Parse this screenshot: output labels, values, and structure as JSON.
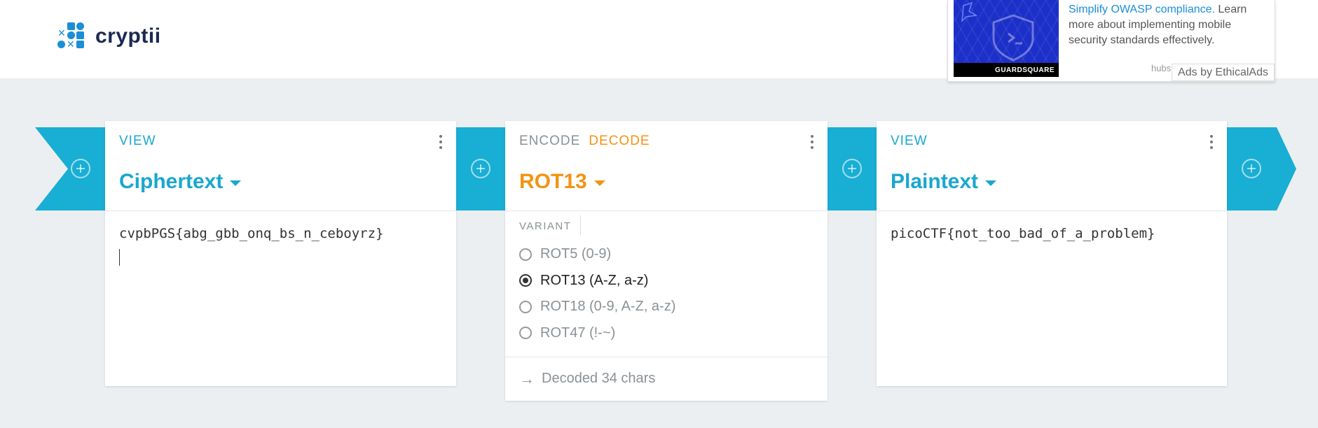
{
  "app": {
    "name": "cryptii"
  },
  "ad": {
    "headline": "Simplify OWASP compliance.",
    "body": " Learn more about implementing mobile security standards effectively.",
    "image_brand": "GUARDSQUARE",
    "domain": "hubs.la",
    "attribution": "Ads by EthicalAds"
  },
  "cards": {
    "ciphertext": {
      "tag": "VIEW",
      "title": "Ciphertext",
      "content": "cvpbPGS{abg_gbb_onq_bs_n_ceboyrz}"
    },
    "rot13": {
      "tag_encode": "ENCODE",
      "tag_decode": "DECODE",
      "title": "ROT13",
      "variant_label": "VARIANT",
      "variants": [
        {
          "label": "ROT5 (0-9)",
          "selected": false
        },
        {
          "label": "ROT13 (A-Z, a-z)",
          "selected": true
        },
        {
          "label": "ROT18 (0-9, A-Z, a-z)",
          "selected": false
        },
        {
          "label": "ROT47 (!-~)",
          "selected": false
        }
      ],
      "status": "Decoded 34 chars"
    },
    "plaintext": {
      "tag": "VIEW",
      "title": "Plaintext",
      "content": "picoCTF{not_too_bad_of_a_problem}"
    }
  },
  "colors": {
    "accent": "#19aed4",
    "view_title": "#1aa7cf",
    "decode": "#f39313",
    "background": "#eceff1"
  },
  "icons": [
    "add-brick-icon",
    "more-options-icon",
    "dropdown-caret-icon",
    "arrow-right-icon"
  ]
}
